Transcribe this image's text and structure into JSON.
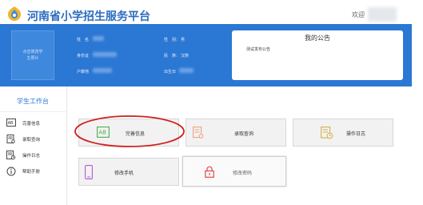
{
  "header": {
    "title": "河南省小学招生服务平台",
    "welcome": "欢迎"
  },
  "profile": {
    "photo_placeholder": [
      "点击修改学",
      "生照片"
    ],
    "fields": {
      "name_label": "姓　名",
      "idcard_label": "身份证",
      "household_label": "户籍地",
      "gender_label": "性　别：",
      "gender_value": "男",
      "ethnicity_label": "民　族：",
      "ethnicity_value": "汉族",
      "birth_label": "出生日"
    }
  },
  "notice": {
    "title": "我的公告",
    "content": "测试发布公告"
  },
  "sidebar": {
    "title": "学生工作台",
    "items": [
      {
        "label": "完善信息",
        "icon": "id-card-icon"
      },
      {
        "label": "录取查询",
        "icon": "document-search-icon"
      },
      {
        "label": "操作日志",
        "icon": "log-icon"
      },
      {
        "label": "帮助手册",
        "icon": "info-icon"
      }
    ]
  },
  "tiles": [
    {
      "label": "完善信息",
      "icon": "id-card-icon",
      "color": "#4caf50"
    },
    {
      "label": "录取查询",
      "icon": "document-search-icon",
      "color": "#f0a27a"
    },
    {
      "label": "操作日志",
      "icon": "log-icon",
      "color": "#d6b04a"
    },
    {
      "label": "修改手机",
      "icon": "phone-icon",
      "color": "#b05ad8"
    },
    {
      "label": "修改密码",
      "icon": "lock-icon",
      "color": "#e04a4a"
    }
  ],
  "colors": {
    "brand": "#2b77d4",
    "annotation": "#d0201c"
  }
}
